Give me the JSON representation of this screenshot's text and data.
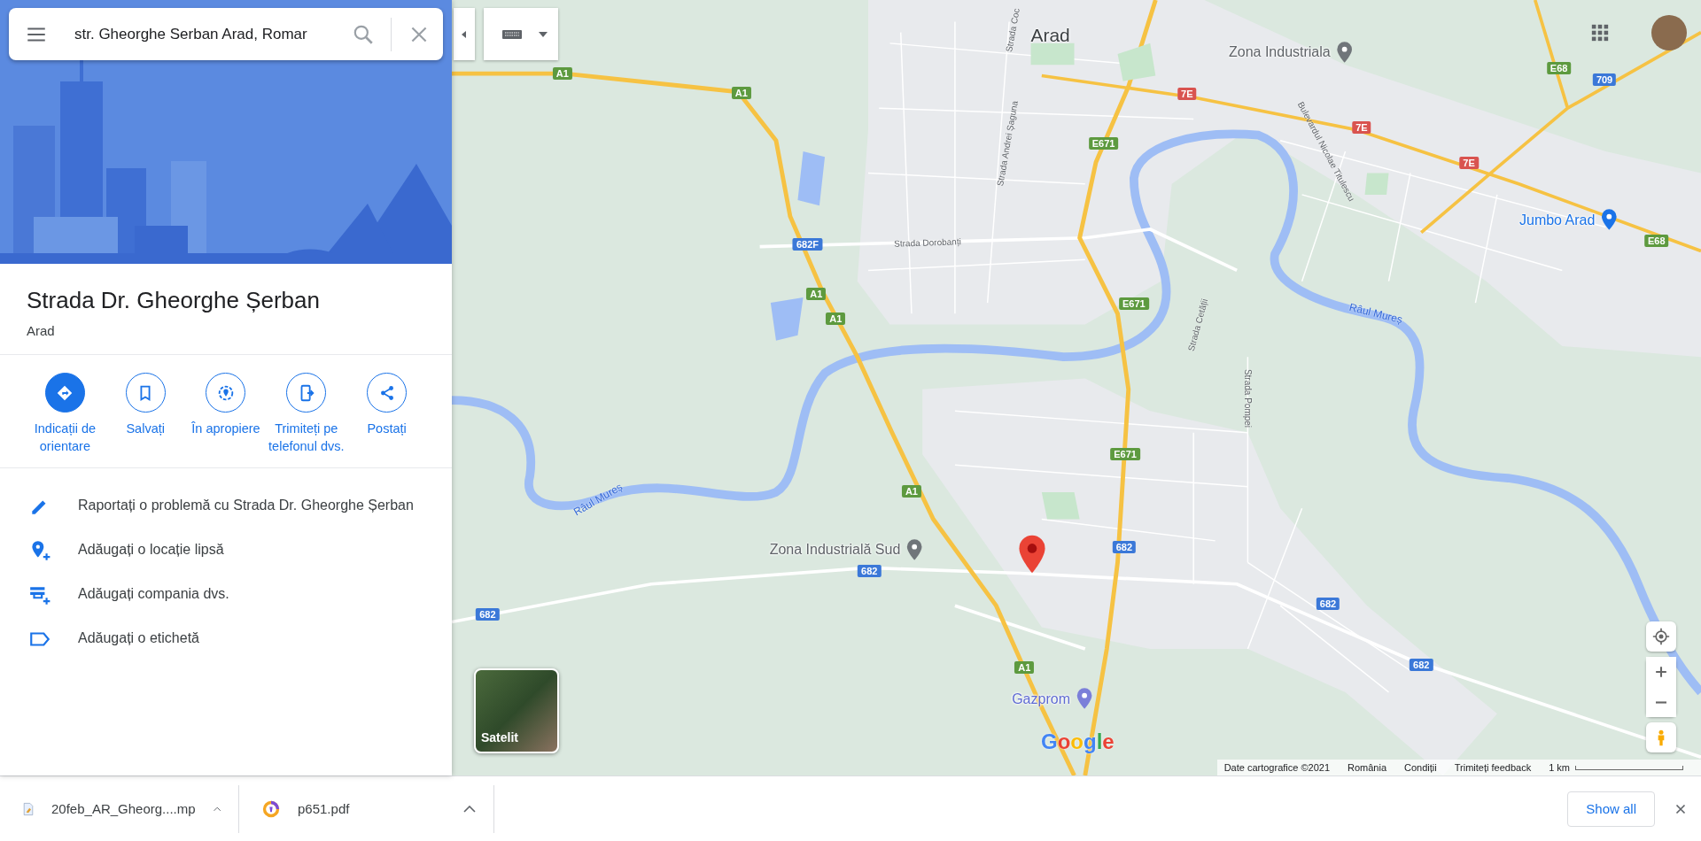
{
  "search": {
    "value": "str. Gheorghe Serban Arad, Romar"
  },
  "place": {
    "title": "Strada Dr. Gheorghe Șerban",
    "subtitle": "Arad"
  },
  "actions": [
    {
      "label": "Indicații de orientare",
      "kind": "directions",
      "filled": true
    },
    {
      "label": "Salvați",
      "kind": "save",
      "filled": false
    },
    {
      "label": "În apropiere",
      "kind": "nearby",
      "filled": false
    },
    {
      "label": "Trimiteți pe telefonul dvs.",
      "kind": "phone",
      "filled": false
    },
    {
      "label": "Postați",
      "kind": "share",
      "filled": false
    }
  ],
  "links": [
    {
      "label": "Raportați o problemă cu Strada Dr. Gheorghe Șerban",
      "kind": "edit"
    },
    {
      "label": "Adăugați o locație lipsă",
      "kind": "add_place"
    },
    {
      "label": "Adăugați compania dvs.",
      "kind": "add_business"
    },
    {
      "label": "Adăugați o etichetă",
      "kind": "label"
    }
  ],
  "map": {
    "places": [
      {
        "label": "Arad",
        "kind": "city"
      },
      {
        "label": "Zona Industriala",
        "kind": "area"
      },
      {
        "label": "Jumbo Arad",
        "kind": "shop"
      },
      {
        "label": "Zona Industrială Sud",
        "kind": "area"
      },
      {
        "label": "Gazprom",
        "kind": "fuel"
      }
    ],
    "rivers": [
      "Râul Mureș",
      "Râul Mureș"
    ],
    "streets": [
      "Strada Coc",
      "Strada Andrei Șaguna",
      "Strada Dorobanți",
      "Bulevardul Nicolae Titulescu",
      "Strada Cetății",
      "Strada Pompei"
    ],
    "shields": [
      {
        "label": "A1",
        "color": "#5d9a3f"
      },
      {
        "label": "A1",
        "color": "#5d9a3f"
      },
      {
        "label": "A1",
        "color": "#5d9a3f"
      },
      {
        "label": "A1",
        "color": "#5d9a3f"
      },
      {
        "label": "A1",
        "color": "#5d9a3f"
      },
      {
        "label": "A1",
        "color": "#5d9a3f"
      },
      {
        "label": "E671",
        "color": "#5d9a3f"
      },
      {
        "label": "E671",
        "color": "#5d9a3f"
      },
      {
        "label": "E671",
        "color": "#5d9a3f"
      },
      {
        "label": "7E",
        "color": "#d9534f"
      },
      {
        "label": "7E",
        "color": "#d9534f"
      },
      {
        "label": "7E",
        "color": "#d9534f"
      },
      {
        "label": "E68",
        "color": "#5d9a3f"
      },
      {
        "label": "E68",
        "color": "#5d9a3f"
      },
      {
        "label": "709",
        "color": "#3b78d8"
      },
      {
        "label": "682F",
        "color": "#3b78d8"
      },
      {
        "label": "682",
        "color": "#3b78d8"
      },
      {
        "label": "682",
        "color": "#3b78d8"
      },
      {
        "label": "682",
        "color": "#3b78d8"
      },
      {
        "label": "682",
        "color": "#3b78d8"
      },
      {
        "label": "682",
        "color": "#3b78d8"
      }
    ],
    "logo": "Google",
    "satellite_label": "Satelit",
    "attribution": [
      "Date cartografice ©2021",
      "România",
      "Condiții",
      "Trimiteți feedback"
    ],
    "scale": "1 km"
  },
  "downloads": [
    {
      "name": "20feb_AR_Gheorg....mp",
      "kind": "image"
    },
    {
      "name": "p651.pdf",
      "kind": "pdf"
    }
  ],
  "show_all": "Show all"
}
